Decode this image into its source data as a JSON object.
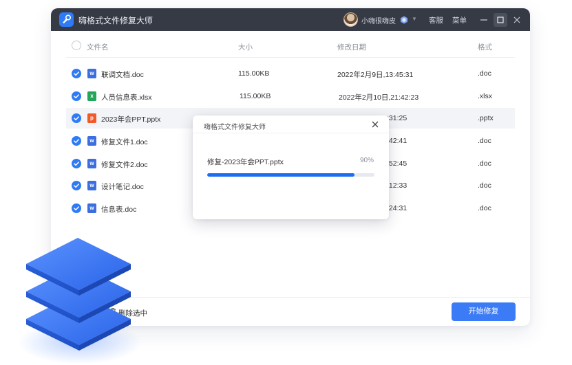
{
  "app": {
    "title": "嗨格式文件修复大师"
  },
  "user": {
    "name": "小嗨很嗨皮"
  },
  "titlebar": {
    "service": "客服",
    "menu": "菜单"
  },
  "columns": {
    "name": "文件名",
    "size": "大小",
    "date": "修改日期",
    "format": "格式"
  },
  "files": [
    {
      "name": "联调文档.doc",
      "size": "115.00KB",
      "date": "2022年2月9日,13:45:31",
      "format": ".doc",
      "type": "W"
    },
    {
      "name": "人员信息表.xlsx",
      "size": "115.00KB",
      "date": "2022年2月10日,21:42:23",
      "format": ".xlsx",
      "type": "X"
    },
    {
      "name": "2023年会PPT.pptx",
      "size": "",
      "date": ":31:25",
      "format": ".pptx",
      "type": "P"
    },
    {
      "name": "修复文件1.doc",
      "size": "",
      "date": ":42:41",
      "format": ".doc",
      "type": "W"
    },
    {
      "name": "修复文件2.doc",
      "size": "",
      "date": ":52:45",
      "format": ".doc",
      "type": "W"
    },
    {
      "name": "设计笔记.doc",
      "size": "",
      "date": ":12:33",
      "format": ".doc",
      "type": "W"
    },
    {
      "name": "信息表.doc",
      "size": "",
      "date": ":24:31",
      "format": ".doc",
      "type": "W"
    }
  ],
  "footer": {
    "delete_selected": "删除选中",
    "start_repair": "开始修复"
  },
  "dialog": {
    "title": "嗨格式文件修复大师",
    "file_label": "修复-2023年会PPT.pptx",
    "percent_label": "90%",
    "progress": 0.88
  },
  "colors": {
    "accent": "#2f7bf5",
    "titlebar": "#353a45",
    "word": "#3b6fe0",
    "excel": "#23a55a",
    "ppt": "#f05a28"
  }
}
